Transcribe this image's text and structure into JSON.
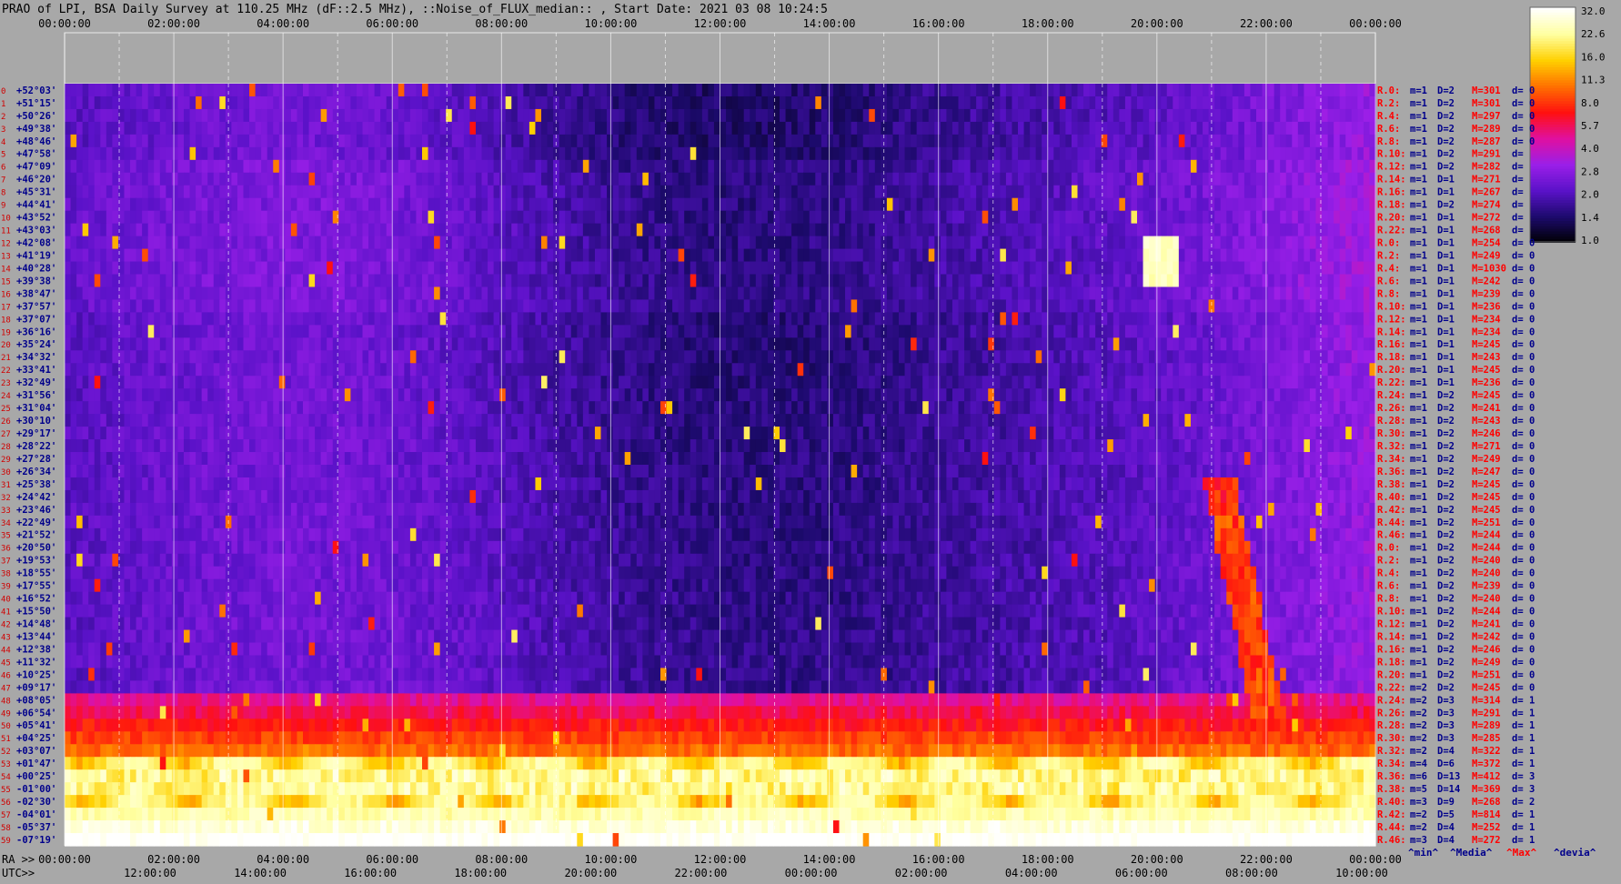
{
  "title": "PRAO of LPI, BSA Daily Survey at 110.25 MHz (dF::2.5 MHz), ::Noise_of_FLUX_median:: , Start Date: 2021 03 08 10:24:5",
  "colors": {
    "background": "#a8a8a8",
    "text": "#000000",
    "stats_label": "#ff0000",
    "stats_value": "#00008b",
    "grid": "#ffffff"
  },
  "chart_data": {
    "type": "heatmap",
    "colormap": [
      "#000000",
      "#1c0a6c",
      "#5a12c8",
      "#9a1fe8",
      "#e010a0",
      "#ff1010",
      "#ff7000",
      "#ffd000",
      "#ffffa0",
      "#ffffff"
    ],
    "colorbar": {
      "ticks": [
        "32.0",
        "22.6",
        "16.0",
        "11.3",
        "8.0",
        "5.7",
        "4.0",
        "2.8",
        "2.0",
        "1.4",
        "1.0"
      ]
    },
    "top_axis": {
      "ticks": [
        "00:00:00",
        "02:00:00",
        "04:00:00",
        "06:00:00",
        "08:00:00",
        "10:00:00",
        "12:00:00",
        "14:00:00",
        "16:00:00",
        "18:00:00",
        "20:00:00",
        "22:00:00",
        "00:00:00"
      ]
    },
    "ra_axis": {
      "prefix": "RA >>",
      "ticks": [
        "00:00:00",
        "02:00:00",
        "04:00:00",
        "06:00:00",
        "08:00:00",
        "10:00:00",
        "12:00:00",
        "14:00:00",
        "16:00:00",
        "18:00:00",
        "20:00:00",
        "22:00:00",
        "00:00:00"
      ]
    },
    "utc_axis": {
      "prefix": "UTC>>",
      "ticks": [
        "12:00:00",
        "14:00:00",
        "16:00:00",
        "18:00:00",
        "20:00:00",
        "22:00:00",
        "00:00:00",
        "02:00:00",
        "04:00:00",
        "06:00:00",
        "08:00:00",
        "10:00:00"
      ]
    },
    "beams": [
      {
        "idx": "0",
        "dec": "+52°03'"
      },
      {
        "idx": "1",
        "dec": "+51°15'"
      },
      {
        "idx": "2",
        "dec": "+50°26'"
      },
      {
        "idx": "3",
        "dec": "+49°38'"
      },
      {
        "idx": "4",
        "dec": "+48°46'"
      },
      {
        "idx": "5",
        "dec": "+47°58'"
      },
      {
        "idx": "6",
        "dec": "+47°09'"
      },
      {
        "idx": "7",
        "dec": "+46°20'"
      },
      {
        "idx": "8",
        "dec": "+45°31'"
      },
      {
        "idx": "9",
        "dec": "+44°41'"
      },
      {
        "idx": "10",
        "dec": "+43°52'"
      },
      {
        "idx": "11",
        "dec": "+43°03'"
      },
      {
        "idx": "12",
        "dec": "+42°08'"
      },
      {
        "idx": "13",
        "dec": "+41°19'"
      },
      {
        "idx": "14",
        "dec": "+40°28'"
      },
      {
        "idx": "15",
        "dec": "+39°38'"
      },
      {
        "idx": "16",
        "dec": "+38°47'"
      },
      {
        "idx": "17",
        "dec": "+37°57'"
      },
      {
        "idx": "18",
        "dec": "+37°07'"
      },
      {
        "idx": "19",
        "dec": "+36°16'"
      },
      {
        "idx": "20",
        "dec": "+35°24'"
      },
      {
        "idx": "21",
        "dec": "+34°32'"
      },
      {
        "idx": "22",
        "dec": "+33°41'"
      },
      {
        "idx": "23",
        "dec": "+32°49'"
      },
      {
        "idx": "24",
        "dec": "+31°56'"
      },
      {
        "idx": "25",
        "dec": "+31°04'"
      },
      {
        "idx": "26",
        "dec": "+30°10'"
      },
      {
        "idx": "27",
        "dec": "+29°17'"
      },
      {
        "idx": "28",
        "dec": "+28°22'"
      },
      {
        "idx": "29",
        "dec": "+27°28'"
      },
      {
        "idx": "30",
        "dec": "+26°34'"
      },
      {
        "idx": "31",
        "dec": "+25°38'"
      },
      {
        "idx": "32",
        "dec": "+24°42'"
      },
      {
        "idx": "33",
        "dec": "+23°46'"
      },
      {
        "idx": "34",
        "dec": "+22°49'"
      },
      {
        "idx": "35",
        "dec": "+21°52'"
      },
      {
        "idx": "36",
        "dec": "+20°50'"
      },
      {
        "idx": "37",
        "dec": "+19°53'"
      },
      {
        "idx": "38",
        "dec": "+18°55'"
      },
      {
        "idx": "39",
        "dec": "+17°55'"
      },
      {
        "idx": "40",
        "dec": "+16°52'"
      },
      {
        "idx": "41",
        "dec": "+15°50'"
      },
      {
        "idx": "42",
        "dec": "+14°48'"
      },
      {
        "idx": "43",
        "dec": "+13°44'"
      },
      {
        "idx": "44",
        "dec": "+12°38'"
      },
      {
        "idx": "45",
        "dec": "+11°32'"
      },
      {
        "idx": "46",
        "dec": "+10°25'"
      },
      {
        "idx": "47",
        "dec": "+09°17'"
      },
      {
        "idx": "48",
        "dec": "+08°05'"
      },
      {
        "idx": "49",
        "dec": "+06°54'"
      },
      {
        "idx": "50",
        "dec": "+05°41'"
      },
      {
        "idx": "51",
        "dec": "+04°25'"
      },
      {
        "idx": "52",
        "dec": "+03°07'"
      },
      {
        "idx": "53",
        "dec": "+01°47'"
      },
      {
        "idx": "54",
        "dec": "+00°25'"
      },
      {
        "idx": "55",
        "dec": "-01°00'"
      },
      {
        "idx": "56",
        "dec": "-02°30'"
      },
      {
        "idx": "57",
        "dec": "-04°01'"
      },
      {
        "idx": "58",
        "dec": "-05°37'"
      },
      {
        "idx": "59",
        "dec": "-07°19'"
      }
    ],
    "stats": [
      {
        "r": "R.0:",
        "m": "m=1",
        "d": "D=2",
        "mx": "M=301",
        "dv": "d= 0"
      },
      {
        "r": "R.2:",
        "m": "m=1",
        "d": "D=2",
        "mx": "M=301",
        "dv": "d= 0"
      },
      {
        "r": "R.4:",
        "m": "m=1",
        "d": "D=2",
        "mx": "M=297",
        "dv": "d= 0"
      },
      {
        "r": "R.6:",
        "m": "m=1",
        "d": "D=2",
        "mx": "M=289",
        "dv": "d= 0"
      },
      {
        "r": "R.8:",
        "m": "m=1",
        "d": "D=2",
        "mx": "M=287",
        "dv": "d= 0"
      },
      {
        "r": "R.10:",
        "m": "m=1",
        "d": "D=2",
        "mx": "M=291",
        "dv": "d="
      },
      {
        "r": "R.12:",
        "m": "m=1",
        "d": "D=2",
        "mx": "M=282",
        "dv": "d="
      },
      {
        "r": "R.14:",
        "m": "m=1",
        "d": "D=1",
        "mx": "M=271",
        "dv": "d="
      },
      {
        "r": "R.16:",
        "m": "m=1",
        "d": "D=1",
        "mx": "M=267",
        "dv": "d="
      },
      {
        "r": "R.18:",
        "m": "m=1",
        "d": "D=2",
        "mx": "M=274",
        "dv": "d="
      },
      {
        "r": "R.20:",
        "m": "m=1",
        "d": "D=1",
        "mx": "M=272",
        "dv": "d="
      },
      {
        "r": "R.22:",
        "m": "m=1",
        "d": "D=1",
        "mx": "M=268",
        "dv": "d="
      },
      {
        "r": "R.0:",
        "m": "m=1",
        "d": "D=1",
        "mx": "M=254",
        "dv": "d= 0"
      },
      {
        "r": "R.2:",
        "m": "m=1",
        "d": "D=1",
        "mx": "M=249",
        "dv": "d= 0"
      },
      {
        "r": "R.4:",
        "m": "m=1",
        "d": "D=1",
        "mx": "M=1030",
        "dv": "d= 0"
      },
      {
        "r": "R.6:",
        "m": "m=1",
        "d": "D=1",
        "mx": "M=242",
        "dv": "d= 0"
      },
      {
        "r": "R.8:",
        "m": "m=1",
        "d": "D=1",
        "mx": "M=239",
        "dv": "d= 0"
      },
      {
        "r": "R.10:",
        "m": "m=1",
        "d": "D=1",
        "mx": "M=236",
        "dv": "d= 0"
      },
      {
        "r": "R.12:",
        "m": "m=1",
        "d": "D=1",
        "mx": "M=234",
        "dv": "d= 0"
      },
      {
        "r": "R.14:",
        "m": "m=1",
        "d": "D=1",
        "mx": "M=234",
        "dv": "d= 0"
      },
      {
        "r": "R.16:",
        "m": "m=1",
        "d": "D=1",
        "mx": "M=245",
        "dv": "d= 0"
      },
      {
        "r": "R.18:",
        "m": "m=1",
        "d": "D=1",
        "mx": "M=243",
        "dv": "d= 0"
      },
      {
        "r": "R.20:",
        "m": "m=1",
        "d": "D=1",
        "mx": "M=245",
        "dv": "d= 0"
      },
      {
        "r": "R.22:",
        "m": "m=1",
        "d": "D=1",
        "mx": "M=236",
        "dv": "d= 0"
      },
      {
        "r": "R.24:",
        "m": "m=1",
        "d": "D=2",
        "mx": "M=245",
        "dv": "d= 0"
      },
      {
        "r": "R.26:",
        "m": "m=1",
        "d": "D=2",
        "mx": "M=241",
        "dv": "d= 0"
      },
      {
        "r": "R.28:",
        "m": "m=1",
        "d": "D=2",
        "mx": "M=243",
        "dv": "d= 0"
      },
      {
        "r": "R.30:",
        "m": "m=1",
        "d": "D=2",
        "mx": "M=246",
        "dv": "d= 0"
      },
      {
        "r": "R.32:",
        "m": "m=1",
        "d": "D=2",
        "mx": "M=271",
        "dv": "d= 0"
      },
      {
        "r": "R.34:",
        "m": "m=1",
        "d": "D=2",
        "mx": "M=249",
        "dv": "d= 0"
      },
      {
        "r": "R.36:",
        "m": "m=1",
        "d": "D=2",
        "mx": "M=247",
        "dv": "d= 0"
      },
      {
        "r": "R.38:",
        "m": "m=1",
        "d": "D=2",
        "mx": "M=245",
        "dv": "d= 0"
      },
      {
        "r": "R.40:",
        "m": "m=1",
        "d": "D=2",
        "mx": "M=245",
        "dv": "d= 0"
      },
      {
        "r": "R.42:",
        "m": "m=1",
        "d": "D=2",
        "mx": "M=245",
        "dv": "d= 0"
      },
      {
        "r": "R.44:",
        "m": "m=1",
        "d": "D=2",
        "mx": "M=251",
        "dv": "d= 0"
      },
      {
        "r": "R.46:",
        "m": "m=1",
        "d": "D=2",
        "mx": "M=244",
        "dv": "d= 0"
      },
      {
        "r": "R.0:",
        "m": "m=1",
        "d": "D=2",
        "mx": "M=244",
        "dv": "d= 0"
      },
      {
        "r": "R.2:",
        "m": "m=1",
        "d": "D=2",
        "mx": "M=240",
        "dv": "d= 0"
      },
      {
        "r": "R.4:",
        "m": "m=1",
        "d": "D=2",
        "mx": "M=240",
        "dv": "d= 0"
      },
      {
        "r": "R.6:",
        "m": "m=1",
        "d": "D=2",
        "mx": "M=239",
        "dv": "d= 0"
      },
      {
        "r": "R.8:",
        "m": "m=1",
        "d": "D=2",
        "mx": "M=240",
        "dv": "d= 0"
      },
      {
        "r": "R.10:",
        "m": "m=1",
        "d": "D=2",
        "mx": "M=244",
        "dv": "d= 0"
      },
      {
        "r": "R.12:",
        "m": "m=1",
        "d": "D=2",
        "mx": "M=241",
        "dv": "d= 0"
      },
      {
        "r": "R.14:",
        "m": "m=1",
        "d": "D=2",
        "mx": "M=242",
        "dv": "d= 0"
      },
      {
        "r": "R.16:",
        "m": "m=1",
        "d": "D=2",
        "mx": "M=246",
        "dv": "d= 0"
      },
      {
        "r": "R.18:",
        "m": "m=1",
        "d": "D=2",
        "mx": "M=249",
        "dv": "d= 0"
      },
      {
        "r": "R.20:",
        "m": "m=1",
        "d": "D=2",
        "mx": "M=251",
        "dv": "d= 0"
      },
      {
        "r": "R.22:",
        "m": "m=2",
        "d": "D=2",
        "mx": "M=245",
        "dv": "d= 0"
      },
      {
        "r": "R.24:",
        "m": "m=2",
        "d": "D=3",
        "mx": "M=314",
        "dv": "d= 1"
      },
      {
        "r": "R.26:",
        "m": "m=2",
        "d": "D=3",
        "mx": "M=291",
        "dv": "d= 1"
      },
      {
        "r": "R.28:",
        "m": "m=2",
        "d": "D=3",
        "mx": "M=289",
        "dv": "d= 1"
      },
      {
        "r": "R.30:",
        "m": "m=2",
        "d": "D=3",
        "mx": "M=285",
        "dv": "d= 1"
      },
      {
        "r": "R.32:",
        "m": "m=2",
        "d": "D=4",
        "mx": "M=322",
        "dv": "d= 1"
      },
      {
        "r": "R.34:",
        "m": "m=4",
        "d": "D=6",
        "mx": "M=372",
        "dv": "d= 1"
      },
      {
        "r": "R.36:",
        "m": "m=6",
        "d": "D=13",
        "mx": "M=412",
        "dv": "d= 3"
      },
      {
        "r": "R.38:",
        "m": "m=5",
        "d": "D=14",
        "mx": "M=369",
        "dv": "d= 3"
      },
      {
        "r": "R.40:",
        "m": "m=3",
        "d": "D=9",
        "mx": "M=268",
        "dv": "d= 2"
      },
      {
        "r": "R.42:",
        "m": "m=2",
        "d": "D=5",
        "mx": "M=814",
        "dv": "d= 1"
      },
      {
        "r": "R.44:",
        "m": "m=2",
        "d": "D=4",
        "mx": "M=252",
        "dv": "d= 1"
      },
      {
        "r": "R.46:",
        "m": "m=3",
        "d": "D=4",
        "mx": "M=272",
        "dv": "d= 1"
      }
    ],
    "stats_footer": [
      "^min^",
      "^Media^",
      "^Max^",
      "^devia^"
    ]
  }
}
